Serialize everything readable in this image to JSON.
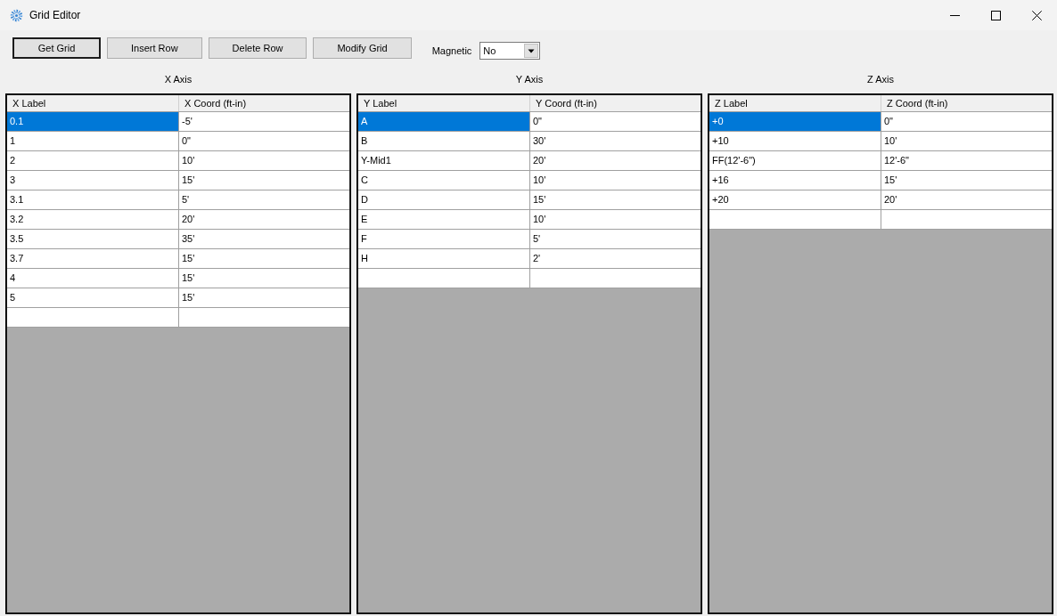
{
  "window": {
    "title": "Grid Editor"
  },
  "toolbar": {
    "buttons": [
      {
        "label": "Get Grid",
        "default": true
      },
      {
        "label": "Insert Row",
        "default": false
      },
      {
        "label": "Delete Row",
        "default": false
      },
      {
        "label": "Modify Grid",
        "default": false
      }
    ],
    "magnetic": {
      "label": "Magnetic",
      "value": "No"
    }
  },
  "grids": [
    {
      "title": "X Axis",
      "columns": [
        "X Label",
        "X Coord (ft-in)"
      ],
      "rows": [
        {
          "cells": [
            "0.1",
            "-5'"
          ],
          "selected": true
        },
        {
          "cells": [
            "1",
            "0\""
          ],
          "selected": false
        },
        {
          "cells": [
            "2",
            "10'"
          ],
          "selected": false
        },
        {
          "cells": [
            "3",
            "15'"
          ],
          "selected": false
        },
        {
          "cells": [
            "3.1",
            "5'"
          ],
          "selected": false
        },
        {
          "cells": [
            "3.2",
            "20'"
          ],
          "selected": false
        },
        {
          "cells": [
            "3.5",
            "35'"
          ],
          "selected": false
        },
        {
          "cells": [
            "3.7",
            "15'"
          ],
          "selected": false
        },
        {
          "cells": [
            "4",
            "15'"
          ],
          "selected": false
        },
        {
          "cells": [
            "5",
            "15'"
          ],
          "selected": false
        }
      ],
      "new_row": true
    },
    {
      "title": "Y Axis",
      "columns": [
        "Y Label",
        "Y Coord (ft-in)"
      ],
      "rows": [
        {
          "cells": [
            "A",
            "0\""
          ],
          "selected": true
        },
        {
          "cells": [
            "B",
            "30'"
          ],
          "selected": false
        },
        {
          "cells": [
            "Y-Mid1",
            "20'"
          ],
          "selected": false
        },
        {
          "cells": [
            "C",
            "10'"
          ],
          "selected": false
        },
        {
          "cells": [
            "D",
            "15'"
          ],
          "selected": false
        },
        {
          "cells": [
            "E",
            "10'"
          ],
          "selected": false
        },
        {
          "cells": [
            "F",
            "5'"
          ],
          "selected": false
        },
        {
          "cells": [
            "H",
            "2'"
          ],
          "selected": false
        }
      ],
      "new_row": true
    },
    {
      "title": "Z Axis",
      "columns": [
        "Z Label",
        "Z Coord (ft-in)"
      ],
      "rows": [
        {
          "cells": [
            "+0",
            "0\""
          ],
          "selected": true
        },
        {
          "cells": [
            "+10",
            "10'"
          ],
          "selected": false
        },
        {
          "cells": [
            "FF(12'-6\")",
            "12'-6\""
          ],
          "selected": false
        },
        {
          "cells": [
            "+16",
            "15'"
          ],
          "selected": false
        },
        {
          "cells": [
            "+20",
            "20'"
          ],
          "selected": false
        }
      ],
      "new_row": true
    }
  ]
}
